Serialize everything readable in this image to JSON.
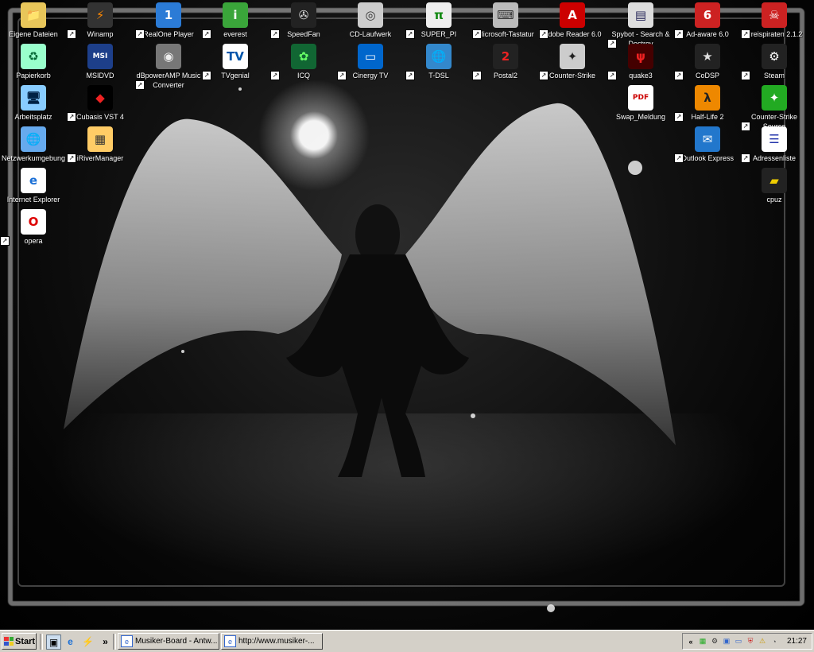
{
  "desktop": {
    "icons": [
      {
        "label": "Eigene Dateien",
        "icon": "folder-icon",
        "symbol": "📁",
        "bg": "#e8c65a",
        "fg": "#7a5a00",
        "shortcut": false
      },
      {
        "label": "Winamp",
        "icon": "winamp-icon",
        "symbol": "⚡",
        "bg": "#333",
        "fg": "#f80",
        "shortcut": true
      },
      {
        "label": "RealOne Player",
        "icon": "realone-icon",
        "symbol": "1",
        "bg": "#2b7bd6",
        "fg": "#fff",
        "shortcut": true
      },
      {
        "label": "everest",
        "icon": "everest-icon",
        "symbol": "i",
        "bg": "#3aa53a",
        "fg": "#fff",
        "shortcut": true
      },
      {
        "label": "SpeedFan",
        "icon": "speedfan-icon",
        "symbol": "✇",
        "bg": "#222",
        "fg": "#ddd",
        "shortcut": true
      },
      {
        "label": "CD-Laufwerk",
        "icon": "cd-drive-icon",
        "symbol": "◎",
        "bg": "#ccc",
        "fg": "#333",
        "shortcut": false
      },
      {
        "label": "SUPER_PI",
        "icon": "superpi-icon",
        "symbol": "π",
        "bg": "#eee",
        "fg": "#118811",
        "shortcut": true
      },
      {
        "label": "Microsoft-Tastatur",
        "icon": "keyboard-icon",
        "symbol": "⌨",
        "bg": "#bbb",
        "fg": "#333",
        "shortcut": true
      },
      {
        "label": "Adobe Reader 6.0",
        "icon": "adobe-reader-icon",
        "symbol": "A",
        "bg": "#c00",
        "fg": "#fff",
        "shortcut": true
      },
      {
        "label": "Spybot - Search & Destroy",
        "icon": "spybot-icon",
        "symbol": "▤",
        "bg": "#ddd",
        "fg": "#225",
        "shortcut": true
      },
      {
        "label": "Ad-aware 6.0",
        "icon": "adaware-icon",
        "symbol": "6",
        "bg": "#c22",
        "fg": "#fff",
        "shortcut": true
      },
      {
        "label": "Preispiraten 2.1.2",
        "icon": "preispiraten-icon",
        "symbol": "☠",
        "bg": "#c22",
        "fg": "#fff",
        "shortcut": true
      },
      {
        "label": "Papierkorb",
        "icon": "recycle-bin-icon",
        "symbol": "♻",
        "bg": "#9fc",
        "fg": "#063",
        "shortcut": false
      },
      {
        "label": "MSIDVD",
        "icon": "msidvd-icon",
        "symbol": "MSI",
        "bg": "#1d3f8a",
        "fg": "#fff",
        "shortcut": false
      },
      {
        "label": "dBpowerAMP Music Converter",
        "icon": "speaker-icon",
        "symbol": "◉",
        "bg": "#777",
        "fg": "#eee",
        "shortcut": true
      },
      {
        "label": "TVgenial",
        "icon": "tvgenial-icon",
        "symbol": "TV",
        "bg": "#fff",
        "fg": "#0055aa",
        "shortcut": true
      },
      {
        "label": "ICQ",
        "icon": "icq-icon",
        "symbol": "✿",
        "bg": "#163",
        "fg": "#6f6",
        "shortcut": true
      },
      {
        "label": "Cinergy TV",
        "icon": "cinergy-tv-icon",
        "symbol": "▭",
        "bg": "#06c",
        "fg": "#fff",
        "shortcut": true
      },
      {
        "label": "T-DSL",
        "icon": "tdsl-icon",
        "symbol": "🌐",
        "bg": "#38c",
        "fg": "#fff",
        "shortcut": true
      },
      {
        "label": "Postal2",
        "icon": "postal2-icon",
        "symbol": "2",
        "bg": "#222",
        "fg": "#e22",
        "shortcut": true
      },
      {
        "label": "Counter-Strike",
        "icon": "counter-strike-icon",
        "symbol": "✦",
        "bg": "#ccc",
        "fg": "#222",
        "shortcut": true
      },
      {
        "label": "quake3",
        "icon": "quake3-icon",
        "symbol": "ψ",
        "bg": "#400",
        "fg": "#e22",
        "shortcut": true
      },
      {
        "label": "CoDSP",
        "icon": "codsp-icon",
        "symbol": "★",
        "bg": "#222",
        "fg": "#ddd",
        "shortcut": true
      },
      {
        "label": "Steam",
        "icon": "steam-icon",
        "symbol": "⚙",
        "bg": "#222",
        "fg": "#fff",
        "shortcut": true
      },
      {
        "label": "Arbeitsplatz",
        "icon": "my-computer-icon",
        "symbol": "🖥",
        "bg": "#8cf",
        "fg": "#024",
        "shortcut": false
      },
      {
        "label": "Cubasis VST 4",
        "icon": "cubasis-icon",
        "symbol": "◆",
        "bg": "#000",
        "fg": "#e22",
        "shortcut": true
      },
      {
        "label": "Swap_Meldung",
        "icon": "pdf-document-icon",
        "symbol": "PDF",
        "bg": "#fff",
        "fg": "#c00",
        "shortcut": false
      },
      {
        "label": "Half-Life 2",
        "icon": "half-life-icon",
        "symbol": "λ",
        "bg": "#e80",
        "fg": "#222",
        "shortcut": true
      },
      {
        "label": "Counter-Strike Source",
        "icon": "cs-source-icon",
        "symbol": "✦",
        "bg": "#2a2",
        "fg": "#fff",
        "shortcut": true
      },
      {
        "label": "Netzwerkumgebung",
        "icon": "network-icon",
        "symbol": "🌐",
        "bg": "#6ae",
        "fg": "#fff",
        "shortcut": false
      },
      {
        "label": "iRiverManager",
        "icon": "iriver-icon",
        "symbol": "▦",
        "bg": "#fc6",
        "fg": "#333",
        "shortcut": true
      },
      {
        "label": "Outlook Express",
        "icon": "outlook-express-icon",
        "symbol": "✉",
        "bg": "#27c",
        "fg": "#fff",
        "shortcut": true
      },
      {
        "label": "Adressenliste",
        "icon": "address-list-icon",
        "symbol": "☰",
        "bg": "#fff",
        "fg": "#23a",
        "shortcut": true
      },
      {
        "label": "Internet Explorer",
        "icon": "internet-explorer-icon",
        "symbol": "e",
        "bg": "#fff",
        "fg": "#1a6fd6",
        "shortcut": false
      },
      {
        "label": "cpuz",
        "icon": "cpuz-icon",
        "symbol": "▰",
        "bg": "#222",
        "fg": "#ec0",
        "shortcut": false
      },
      {
        "label": "opera",
        "icon": "opera-icon",
        "symbol": "O",
        "bg": "#fff",
        "fg": "#d00",
        "shortcut": true
      }
    ]
  },
  "taskbar": {
    "start_label": "Start",
    "quicklaunch": [
      {
        "icon": "show-desktop-icon",
        "symbol": "▣"
      },
      {
        "icon": "internet-explorer-icon",
        "symbol": "e"
      },
      {
        "icon": "winamp-icon",
        "symbol": "⚡"
      }
    ],
    "overflow_label": "»",
    "tasks": [
      {
        "label": "Musiker-Board - Antw...",
        "icon": "ie-window-icon"
      },
      {
        "label": "http://www.musiker-...",
        "icon": "ie-window-icon"
      }
    ],
    "tray": {
      "expand_label": "«",
      "icons": [
        "network-tray-icon",
        "steam-tray-icon",
        "display-tray-icon",
        "monitor-tray-icon",
        "antivirus-tray-icon",
        "security-warning-icon",
        "connection-tray-icon"
      ],
      "clock": "21:27"
    }
  }
}
